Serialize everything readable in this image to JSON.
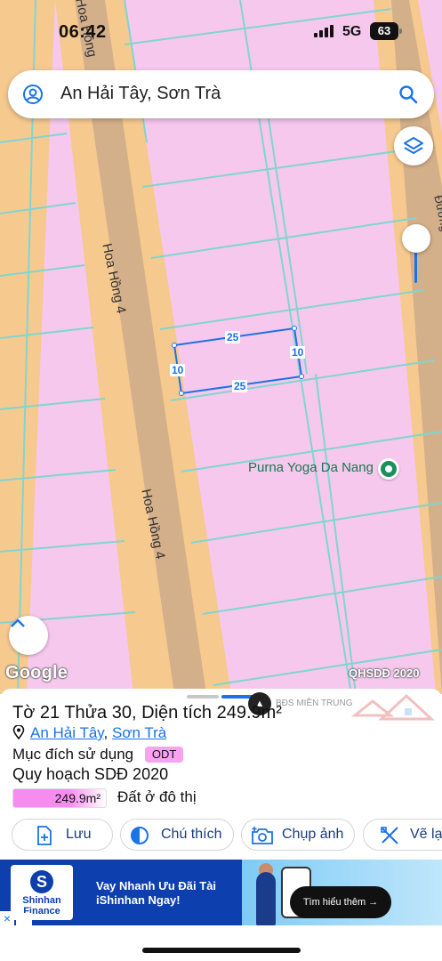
{
  "status": {
    "time": "06:42",
    "network": "5G",
    "battery": "63"
  },
  "search": {
    "text": "An Hải Tây, Sơn Trà"
  },
  "map": {
    "roads": [
      "Hoa Hồng 4",
      "Hoa Hồng 4",
      "Hoa Hồng",
      "Đường"
    ],
    "poi": "Purna Yoga Da Nang",
    "parcel_dims": {
      "top": "25",
      "bottom": "25",
      "left": "10",
      "right": "10"
    },
    "logo": "Google",
    "credit": "QHSDĐ 2020"
  },
  "sheet": {
    "title": "Tờ 21 Thửa 30, Diện tích 249.9m²",
    "location_ward": "An Hải Tây",
    "location_sep": ", ",
    "location_district": "Sơn Trà",
    "usage_label": "Mục đích sử dụng",
    "usage_code": "ODT",
    "plan_label": "Quy hoạch SDĐ 2020",
    "area_value": "249.9m²",
    "area_desc": "Đất ở đô thị",
    "watermark_text": "BĐS MIỀN TRUNG"
  },
  "actions": {
    "save": "Lưu",
    "note": "Chú thích",
    "photo": "Chụp ảnh",
    "draw": "Vẽ lại"
  },
  "ad": {
    "logo_line1": "Shinhan",
    "logo_line2": "Finance",
    "headline_line1": "Vay Nhanh Ưu Đãi Tài",
    "headline_line2": "iShinhan Ngay!",
    "cta": "Tìm hiểu thêm →"
  },
  "colors": {
    "parcel_fill": "#f6c8ee",
    "road_fill": "#f6c98f",
    "road_center": "#d8b58a",
    "grid_line": "#7fd6d0",
    "accent": "#1a73e8"
  }
}
